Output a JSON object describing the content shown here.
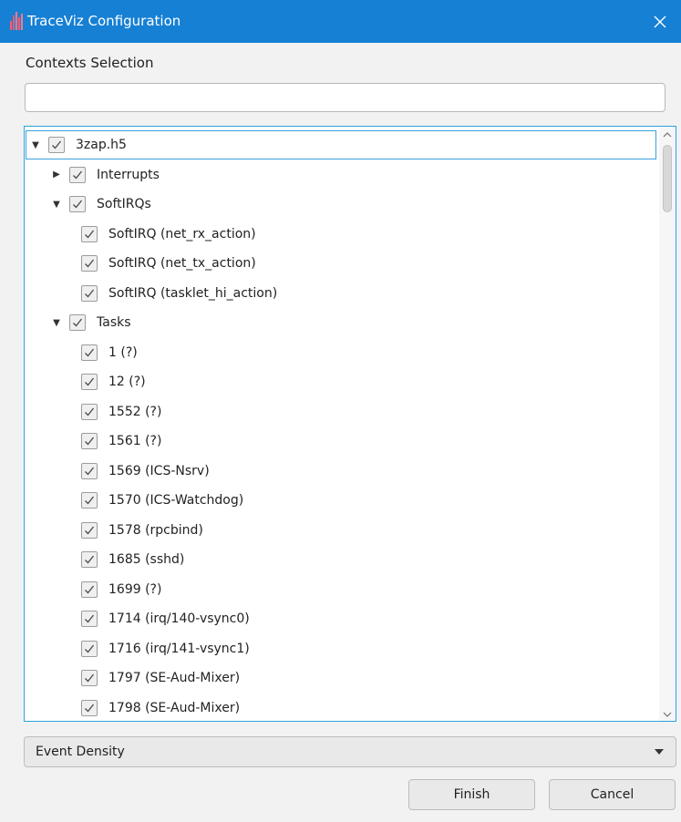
{
  "window": {
    "title": "TraceViz Configuration",
    "title_bar_color": "#1680d4"
  },
  "contexts_label": "Contexts Selection",
  "search": {
    "value": "",
    "placeholder": ""
  },
  "tree": {
    "rows": [
      {
        "label": "3zap.h5",
        "level": 0,
        "expander": "expanded",
        "checked": true,
        "selected": true
      },
      {
        "label": "Interrupts",
        "level": 1,
        "expander": "collapsed",
        "checked": true
      },
      {
        "label": "SoftIRQs",
        "level": 1,
        "expander": "expanded",
        "checked": true
      },
      {
        "label": "SoftIRQ (net_rx_action)",
        "level": 2,
        "expander": "none",
        "checked": true
      },
      {
        "label": "SoftIRQ (net_tx_action)",
        "level": 2,
        "expander": "none",
        "checked": true
      },
      {
        "label": "SoftIRQ (tasklet_hi_action)",
        "level": 2,
        "expander": "none",
        "checked": true
      },
      {
        "label": "Tasks",
        "level": 1,
        "expander": "expanded",
        "checked": true
      },
      {
        "label": "1 (?)",
        "level": 2,
        "expander": "none",
        "checked": true
      },
      {
        "label": "12 (?)",
        "level": 2,
        "expander": "none",
        "checked": true
      },
      {
        "label": "1552 (?)",
        "level": 2,
        "expander": "none",
        "checked": true
      },
      {
        "label": "1561 (?)",
        "level": 2,
        "expander": "none",
        "checked": true
      },
      {
        "label": "1569 (ICS-Nsrv)",
        "level": 2,
        "expander": "none",
        "checked": true
      },
      {
        "label": "1570 (ICS-Watchdog)",
        "level": 2,
        "expander": "none",
        "checked": true
      },
      {
        "label": "1578 (rpcbind)",
        "level": 2,
        "expander": "none",
        "checked": true
      },
      {
        "label": "1685 (sshd)",
        "level": 2,
        "expander": "none",
        "checked": true
      },
      {
        "label": "1699 (?)",
        "level": 2,
        "expander": "none",
        "checked": true
      },
      {
        "label": "1714 (irq/140-vsync0)",
        "level": 2,
        "expander": "none",
        "checked": true
      },
      {
        "label": "1716 (irq/141-vsync1)",
        "level": 2,
        "expander": "none",
        "checked": true
      },
      {
        "label": "1797 (SE-Aud-Mixer)",
        "level": 2,
        "expander": "none",
        "checked": true
      },
      {
        "label": "1798 (SE-Aud-Mixer)",
        "level": 2,
        "expander": "none",
        "checked": true
      }
    ]
  },
  "view_select": {
    "selected": "Event Density"
  },
  "buttons": {
    "finish": "Finish",
    "cancel": "Cancel"
  },
  "icons": {
    "app": "bar-chart-icon",
    "close": "close-icon",
    "expanded": "triangle-down-icon",
    "collapsed": "triangle-right-icon",
    "check": "check-icon",
    "dropdown": "caret-down-icon"
  }
}
